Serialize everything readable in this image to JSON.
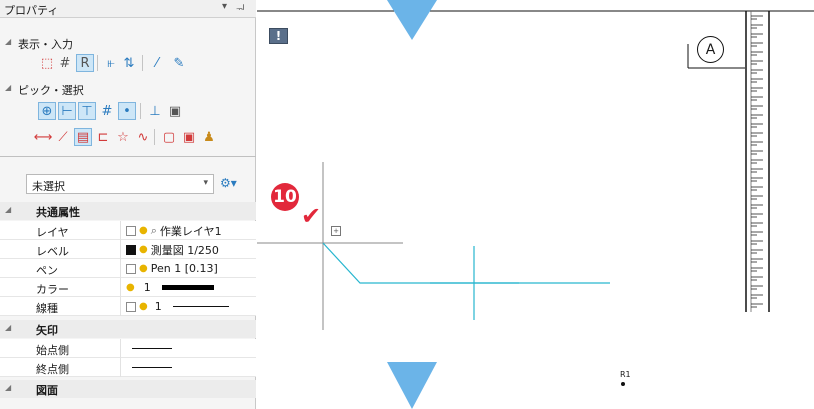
{
  "panel": {
    "title": "プロパティ",
    "title_icons": [
      "dropdown-icon",
      "pin-icon"
    ],
    "section_display": "表示・入力",
    "section_pick": "ピック・選択",
    "selection": "未選択",
    "groups": {
      "common": "共通属性",
      "arrow": "矢印",
      "drawing": "図面"
    },
    "props": {
      "layer": {
        "name": "レイヤ",
        "value": "作業レイヤ1"
      },
      "level": {
        "name": "レベル",
        "value": "測量図 1/250"
      },
      "pen": {
        "name": "ペン",
        "value": "Pen 1 [0.13]"
      },
      "color": {
        "name": "カラー",
        "value": "1"
      },
      "linetype": {
        "name": "線種",
        "value": "1"
      },
      "start": {
        "name": "始点側"
      },
      "end": {
        "name": "終点側"
      }
    }
  },
  "canvas": {
    "info_label": "!",
    "circle_mark": "A",
    "step_number": "10",
    "point_label": "R1",
    "colors": {
      "guide_blue": "#6bb4e8",
      "cyan_line": "#27b6cf",
      "step_red": "#e2283b",
      "crosshair": "#8a8a8a"
    }
  }
}
